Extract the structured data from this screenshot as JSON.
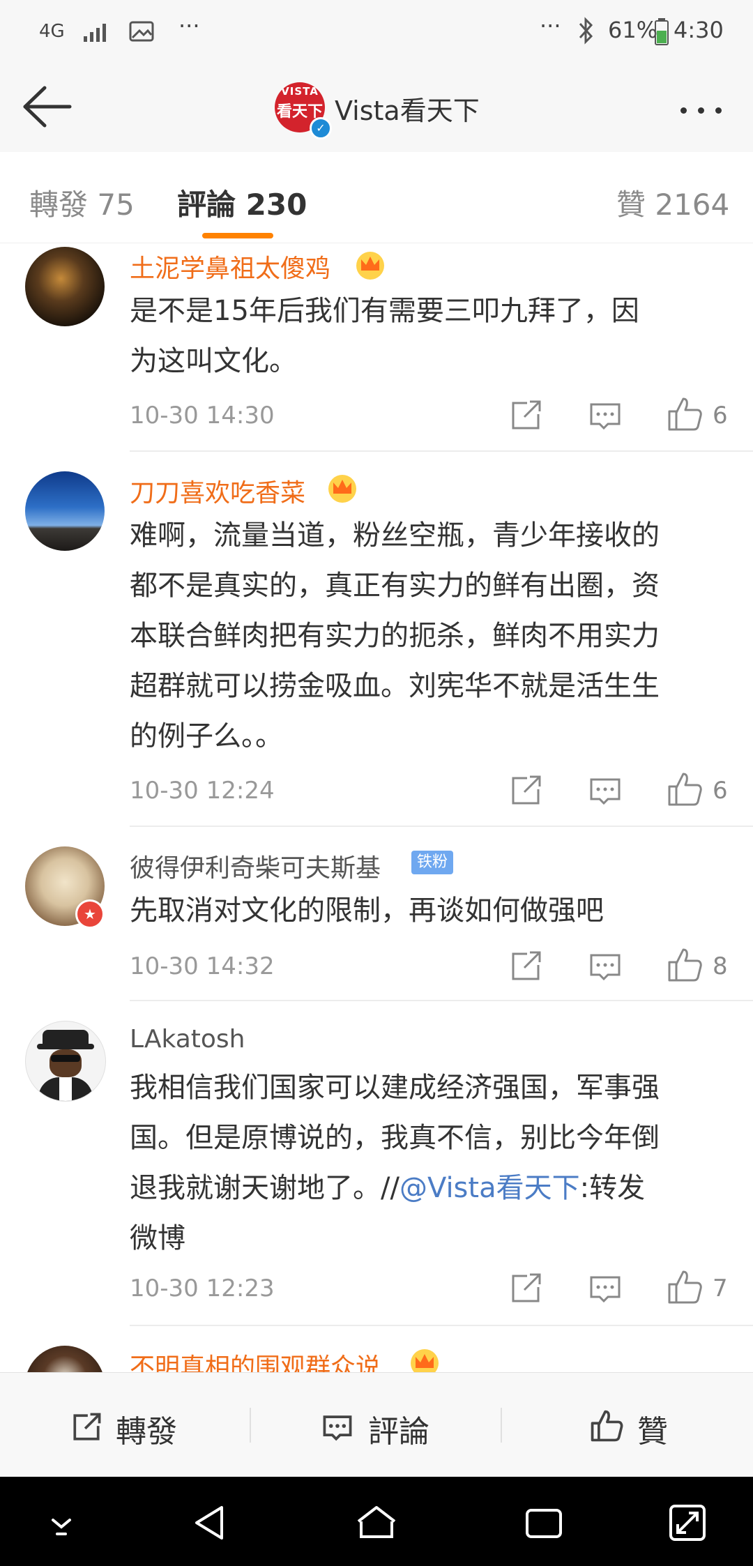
{
  "status_bar": {
    "network": "4G",
    "battery": "61%",
    "time": "4:30"
  },
  "header": {
    "brand_logo_top": "VISTA",
    "brand_logo_main": "看天下",
    "title": "Vista看天下"
  },
  "tabs": {
    "repost": "轉發 75",
    "comments": "評論 230",
    "likes": "贊 2164"
  },
  "comments": [
    {
      "user": "土泥学鼻祖太傻鸡",
      "lines": [
        "是不是15年后我们有需要三叩九拜了，因",
        "为这叫文化。"
      ],
      "time": "10-30 14:30",
      "likes": "6"
    },
    {
      "user": "刀刀喜欢吃香菜",
      "lines": [
        "难啊，流量当道，粉丝空瓶，青少年接收的",
        "都不是真实的，真正有实力的鲜有出圈，资",
        "本联合鲜肉把有实力的扼杀，鲜肉不用实力",
        "超群就可以捞金吸血。刘宪华不就是活生生",
        "的例子么。。"
      ],
      "time": "10-30 12:24",
      "likes": "6"
    },
    {
      "user": "彼得伊利奇柴可夫斯基",
      "badge": "铁粉",
      "lines": [
        "先取消对文化的限制，再谈如何做强吧"
      ],
      "time": "10-30 14:32",
      "likes": "8"
    },
    {
      "user": "LAkatosh",
      "lines": [
        "我相信我们国家可以建成经济强国，军事强",
        "国。但是原博说的，我真不信，别比今年倒"
      ],
      "line3_prefix": "退我就谢天谢地了。//",
      "mention": "@Vista看天下",
      "line3_suffix": ":转发",
      "line4": "微博",
      "time": "10-30 12:23",
      "likes": "7"
    },
    {
      "user": "不明真相的围观群众说"
    }
  ],
  "bottom_bar": {
    "repost": "轉發",
    "comment": "評論",
    "like": "贊"
  }
}
